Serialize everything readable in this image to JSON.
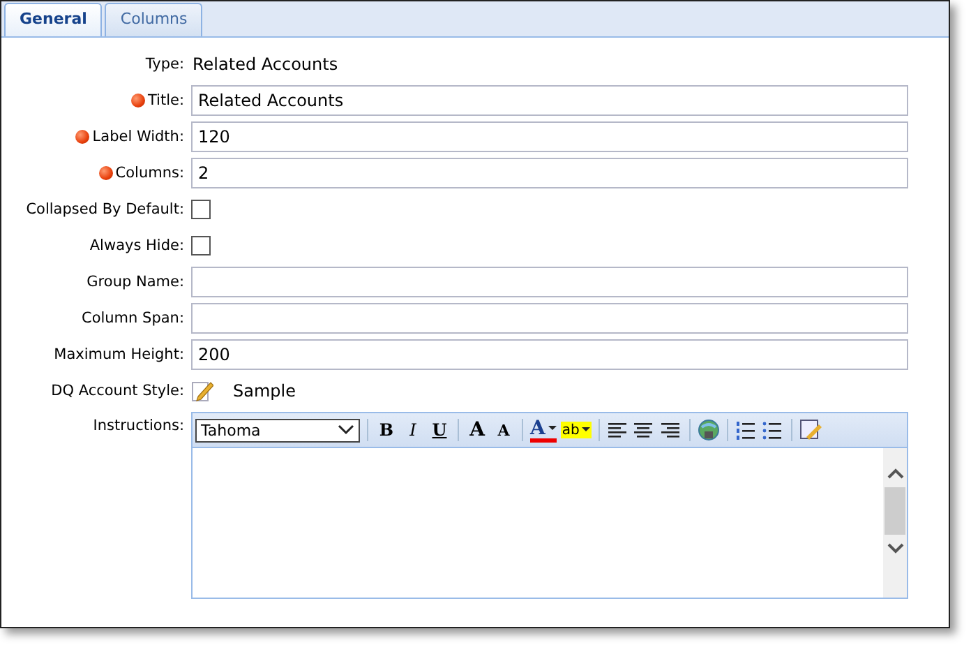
{
  "tabs": [
    {
      "label": "General",
      "selected": true
    },
    {
      "label": "Columns",
      "selected": false
    }
  ],
  "fields": [
    {
      "kind": "text",
      "label": "Type:",
      "required": false,
      "value": "Related Accounts"
    },
    {
      "kind": "input",
      "label": "Title:",
      "required": true,
      "value": "Related Accounts"
    },
    {
      "kind": "input",
      "label": "Label Width:",
      "required": true,
      "value": "120"
    },
    {
      "kind": "input",
      "label": "Columns:",
      "required": true,
      "value": "2"
    },
    {
      "kind": "checkbox",
      "label": "Collapsed By Default:",
      "required": false,
      "checked": false
    },
    {
      "kind": "checkbox",
      "label": "Always Hide:",
      "required": false,
      "checked": false
    },
    {
      "kind": "input",
      "label": "Group Name:",
      "required": false
    },
    {
      "kind": "input",
      "label": "Column Span:",
      "required": false
    },
    {
      "kind": "input",
      "label": "Maximum Height:",
      "required": false,
      "value": "200"
    },
    {
      "kind": "style",
      "label": "DQ Account Style:",
      "required": false,
      "value": "Sample"
    },
    {
      "kind": "editor",
      "label": "Instructions:",
      "required": false
    }
  ],
  "editor": {
    "font": "Tahoma",
    "toolbar": [
      {
        "kind": "bold",
        "label": "B"
      },
      {
        "kind": "italic",
        "label": "I"
      },
      {
        "kind": "underline",
        "label": "U"
      },
      {
        "kind": "sep"
      },
      {
        "kind": "grow",
        "label": "A"
      },
      {
        "kind": "shrink",
        "label": "A"
      },
      {
        "kind": "sep"
      },
      {
        "kind": "forecolor",
        "label": "A"
      },
      {
        "kind": "highlight",
        "label": "ab"
      },
      {
        "kind": "sep"
      },
      {
        "kind": "align-left"
      },
      {
        "kind": "align-center"
      },
      {
        "kind": "align-right"
      },
      {
        "kind": "sep"
      },
      {
        "kind": "link"
      },
      {
        "kind": "sep"
      },
      {
        "kind": "ordered-list"
      },
      {
        "kind": "bullet-list"
      },
      {
        "kind": "sep"
      },
      {
        "kind": "source"
      }
    ]
  }
}
